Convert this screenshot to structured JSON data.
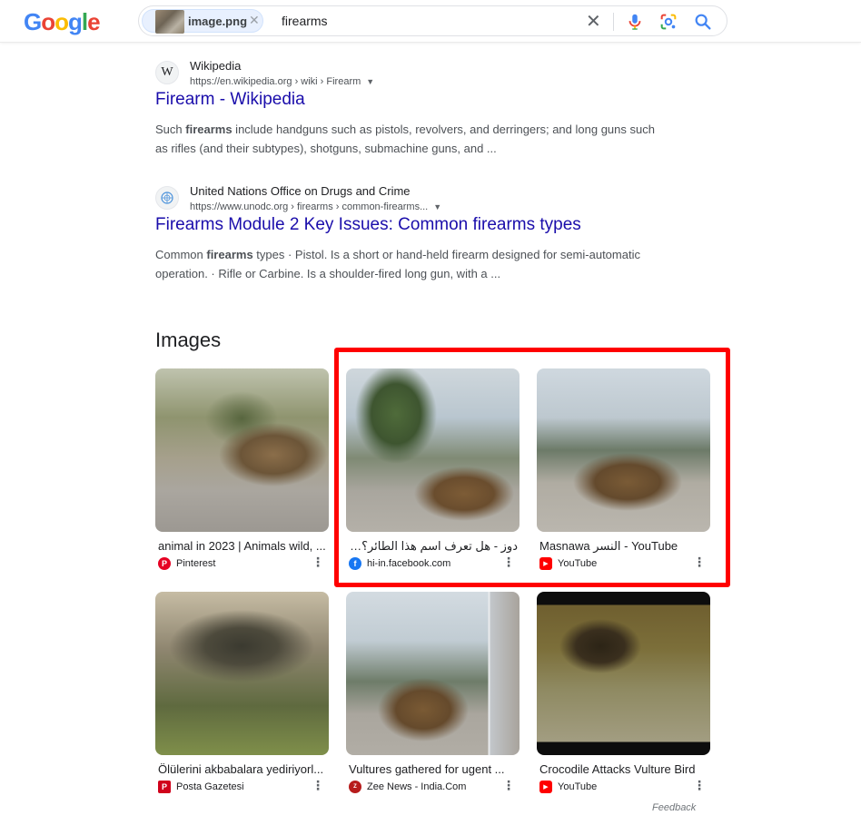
{
  "header": {
    "logo_letters": [
      {
        "ch": "G",
        "color": "#4285F4"
      },
      {
        "ch": "o",
        "color": "#EA4335"
      },
      {
        "ch": "o",
        "color": "#FBBC05"
      },
      {
        "ch": "g",
        "color": "#4285F4"
      },
      {
        "ch": "l",
        "color": "#34A853"
      },
      {
        "ch": "e",
        "color": "#EA4335"
      }
    ],
    "image_chip_label": "image.png",
    "query": "firearms"
  },
  "results": [
    {
      "favicon": "W",
      "site_name": "Wikipedia",
      "url": "https://en.wikipedia.org › wiki › Firearm",
      "title": "Firearm - Wikipedia",
      "snippet_line1_pre": "Such ",
      "snippet_line1_bold": "firearms",
      "snippet_line1_post": " include handguns such as pistols, revolvers, and derringers; and long guns such",
      "snippet_line2": "as rifles (and their subtypes), shotguns, submachine guns, and ..."
    },
    {
      "favicon": "un-emblem-icon",
      "site_name": "United Nations Office on Drugs and Crime",
      "url": "https://www.unodc.org › firearms › common-firearms...",
      "title": "Firearms Module 2 Key Issues: Common firearms types",
      "snippet_line1_pre": "Common ",
      "snippet_line1_bold": "firearms",
      "snippet_line1_post": " types · Pistol. Is a short or hand-held firearm designed for semi-automatic",
      "snippet_line2": "operation. · Rifle or Carbine. Is a shoulder-fired long gun, with a ..."
    }
  ],
  "images_heading": "Images",
  "image_cards": [
    {
      "title": "animal in 2023 | Animals wild, ...",
      "source": "Pinterest",
      "source_icon": "pinterest-icon",
      "icon_color": "#E60023"
    },
    {
      "title": "دوز - هل تعرف اسم هذا الطائر؟ Dooz",
      "source": "hi-in.facebook.com",
      "source_icon": "facebook-icon",
      "icon_color": "#1877F2"
    },
    {
      "title": "Masnawa النسر - YouTube",
      "source": "YouTube",
      "source_icon": "youtube-icon",
      "icon_color": "#FF0000"
    },
    {
      "title": "Ölülerini akbabalara yediriyorl...",
      "source": "Posta Gazetesi",
      "source_icon": "posta-icon",
      "icon_color": "#D0021B"
    },
    {
      "title": "Vultures gathered for ugent ...",
      "source": "Zee News - India.Com",
      "source_icon": "zee-news-icon",
      "icon_color": "#B71C1C"
    },
    {
      "title": "Crocodile Attacks Vulture Bird",
      "source": "YouTube",
      "source_icon": "youtube-icon",
      "icon_color": "#FF0000"
    }
  ],
  "feedback": "Feedback",
  "highlight_color": "#FF0000"
}
